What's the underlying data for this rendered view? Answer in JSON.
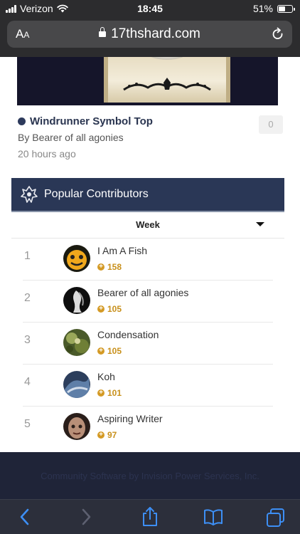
{
  "status_bar": {
    "carrier": "Verizon",
    "time": "18:45",
    "battery": "51%",
    "battery_level": 0.51
  },
  "browser": {
    "text_size_label": "AA",
    "url": "17thshard.com"
  },
  "topic": {
    "title": "Windrunner Symbol Top",
    "author": "By Bearer of all agonies",
    "time": "20 hours ago",
    "reply_count": "0"
  },
  "widget": {
    "title": "Popular Contributors",
    "tab": "Week",
    "contributors": [
      {
        "rank": "1",
        "name": "I Am A Fish",
        "rep": "158"
      },
      {
        "rank": "2",
        "name": "Bearer of all agonies",
        "rep": "105"
      },
      {
        "rank": "3",
        "name": "Condensation",
        "rep": "105"
      },
      {
        "rank": "4",
        "name": "Koh",
        "rep": "101"
      },
      {
        "rank": "5",
        "name": "Aspiring Writer",
        "rep": "97"
      }
    ]
  },
  "footer": {
    "text": "Community Software by Invision Power Services, Inc."
  },
  "colors": {
    "header": "#2a3756",
    "accent": "#c8901b",
    "link": "#2a3550"
  },
  "icons": [
    "wifi-icon",
    "lock-icon",
    "reload-icon",
    "back-icon",
    "forward-icon",
    "share-icon",
    "bookmarks-icon",
    "tabs-icon"
  ]
}
